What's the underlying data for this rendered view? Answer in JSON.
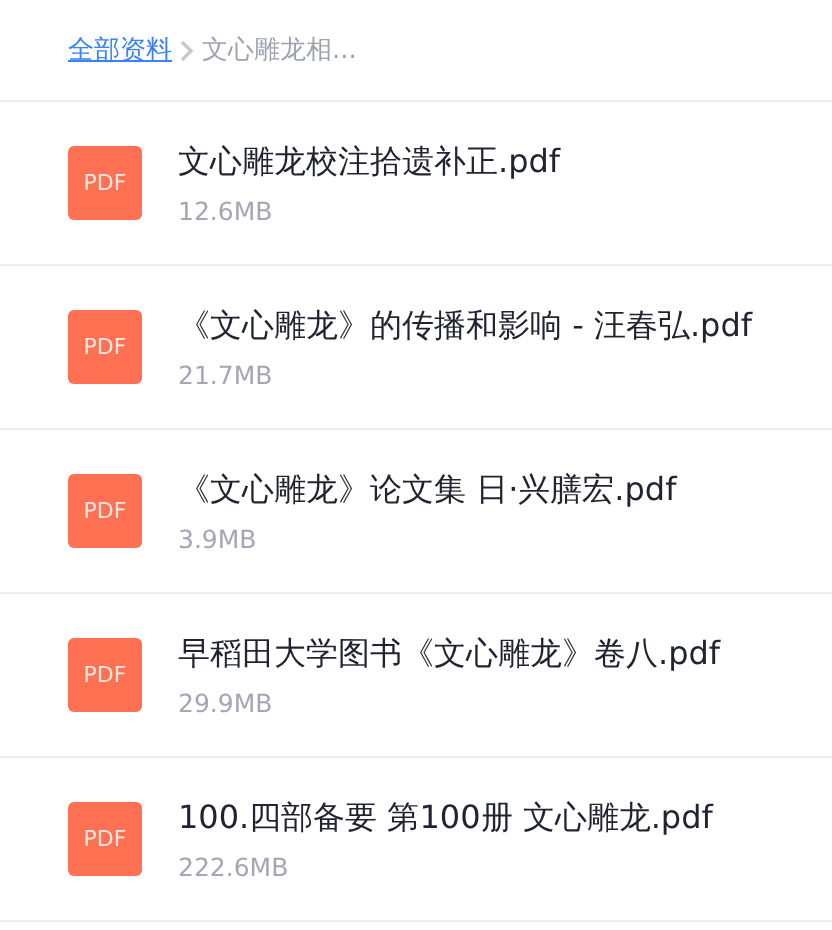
{
  "breadcrumb": [
    {
      "label": "全部资料",
      "kind": "link"
    },
    {
      "label": "文心雕龙相...",
      "kind": "current"
    }
  ],
  "files": [
    {
      "badge": "PDF",
      "name": "文心雕龙校注拾遗补正.pdf",
      "size": "12.6MB"
    },
    {
      "badge": "PDF",
      "name": "《文心雕龙》的传播和影响 - 汪春弘.pdf",
      "size": "21.7MB"
    },
    {
      "badge": "PDF",
      "name": "《文心雕龙》论文集 日·兴膳宏.pdf",
      "size": "3.9MB"
    },
    {
      "badge": "PDF",
      "name": "早稻田大学图书《文心雕龙》卷八.pdf",
      "size": "29.9MB"
    },
    {
      "badge": "PDF",
      "name": "100.四部备要 第100册 文心雕龙.pdf",
      "size": "222.6MB"
    }
  ]
}
